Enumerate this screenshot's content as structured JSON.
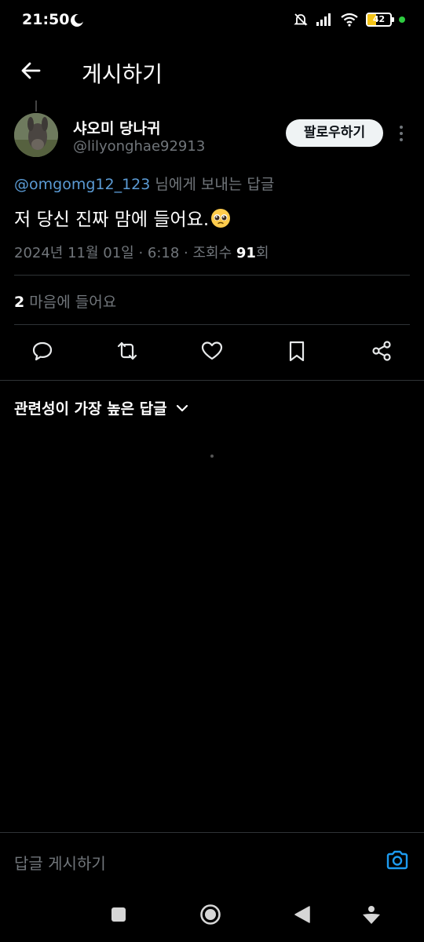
{
  "status_bar": {
    "time": "21:50",
    "battery_level": "42",
    "icons": [
      "moon-icon",
      "mute-bell-icon",
      "signal-icon",
      "wifi-icon",
      "battery-icon",
      "privacy-dot"
    ]
  },
  "header": {
    "title": "게시하기",
    "back_icon": "arrow-left-icon"
  },
  "post": {
    "display_name": "샤오미 당나귀",
    "handle": "@lilyonghae92913",
    "follow_label": "팔로우하기",
    "reply_to_mention": "@omgomg12_123",
    "reply_to_suffix": " 님에게 보내는 답글",
    "text": "저 당신 진짜 맘에 들어요.",
    "emoji": "pleading-face",
    "timestamp": "2024년 11월 01일 · 6:18 · 조회수 ",
    "views": "91",
    "views_suffix": "회",
    "likes_count": "2",
    "likes_label": " 마음에 들어요"
  },
  "actions": [
    "reply-icon",
    "repost-icon",
    "like-icon",
    "bookmark-icon",
    "share-icon"
  ],
  "replies": {
    "sort_label": "관련성이 가장 높은 답글"
  },
  "composer": {
    "placeholder": "답글 게시하기"
  },
  "nav_bar": [
    "recents-button",
    "home-button",
    "back-button",
    "assistant-button"
  ],
  "colors": {
    "background": "#000000",
    "text": "#e7e9ea",
    "muted": "#71767b",
    "mention": "#5b9bd5",
    "accent": "#1d9bf0",
    "follow_bg": "#eff3f4"
  }
}
